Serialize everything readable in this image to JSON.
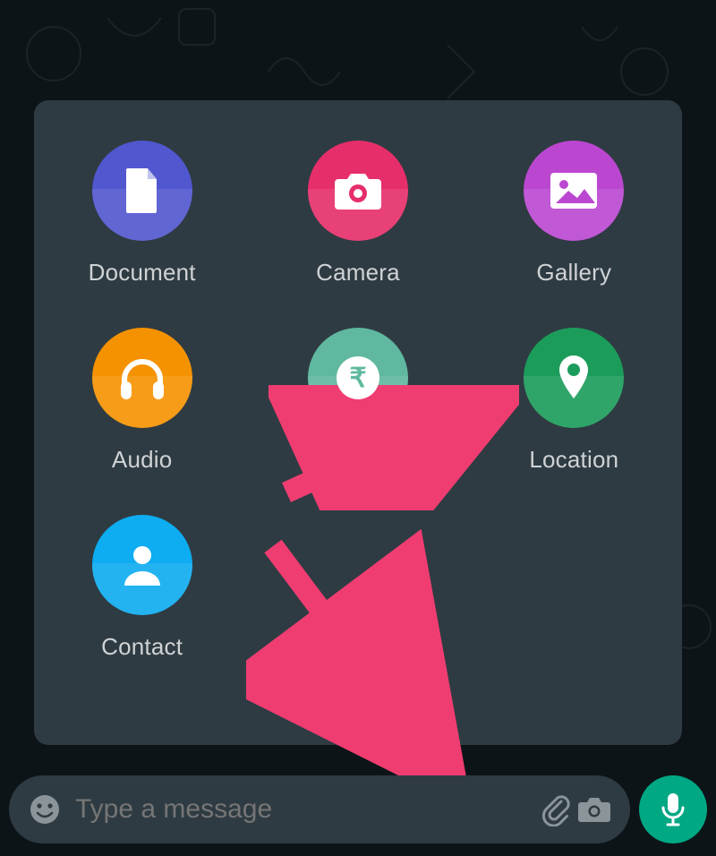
{
  "attachments": {
    "document": "Document",
    "camera": "Camera",
    "gallery": "Gallery",
    "audio": "Audio",
    "payment": "Payment",
    "location": "Location",
    "contact": "Contact"
  },
  "input": {
    "placeholder": "Type a message"
  },
  "colors": {
    "panel_bg": "#2f3b42",
    "mic_bg": "#00a884",
    "arrow": "#ef3d72",
    "document": "#5157cf",
    "camera": "#e62e6b",
    "gallery": "#bb47d1",
    "audio": "#f59202",
    "payment": "#5fb89f",
    "location": "#1c9c5b",
    "contact": "#0eacf0"
  }
}
